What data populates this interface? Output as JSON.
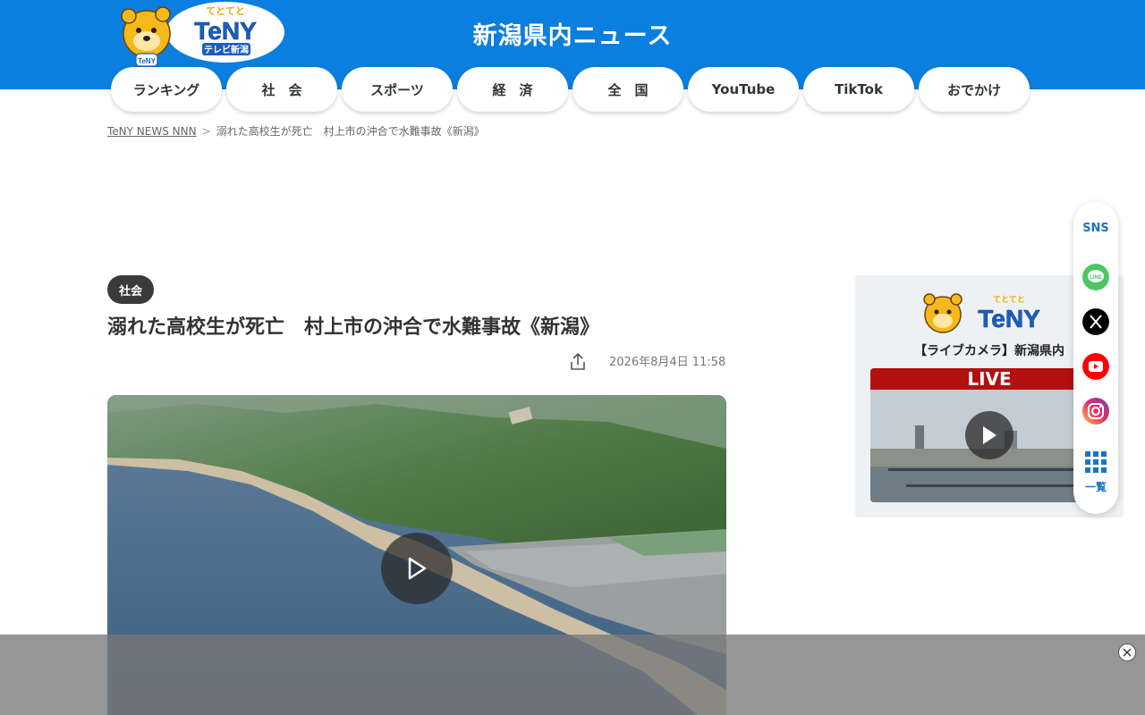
{
  "header": {
    "logo_text": "TeNY",
    "logo_sub": "テレビ新潟",
    "site_title": "新潟県内ニュース"
  },
  "nav": {
    "items": [
      {
        "label": "ランキング"
      },
      {
        "label": "社　会"
      },
      {
        "label": "スポーツ"
      },
      {
        "label": "経　済"
      },
      {
        "label": "全　国"
      },
      {
        "label": "YouTube"
      },
      {
        "label": "TikTok"
      },
      {
        "label": "おでかけ"
      }
    ]
  },
  "breadcrumb": {
    "home": "TeNY NEWS NNN",
    "separator": ">",
    "current": "溺れた高校生が死亡　村上市の沖合で水難事故《新潟》"
  },
  "article": {
    "category": "社会",
    "title": "溺れた高校生が死亡　村上市の沖合で水難事故《新潟》",
    "published": "2026年8月4日 11:58"
  },
  "live_widget": {
    "logo_text": "TeNY",
    "caption": "【ライブカメラ】新潟県内",
    "live_label": "LIVE"
  },
  "sns": {
    "title": "SNS",
    "icons": [
      "line-icon",
      "x-icon",
      "youtube-icon",
      "instagram-icon"
    ],
    "more_label": "一覧"
  },
  "colors": {
    "brand_blue": "#0a7fe0",
    "badge_dark": "#3a3a3a",
    "live_red": "#b40f0f",
    "line_green": "#4cc764",
    "youtube_red": "#ff0000"
  }
}
